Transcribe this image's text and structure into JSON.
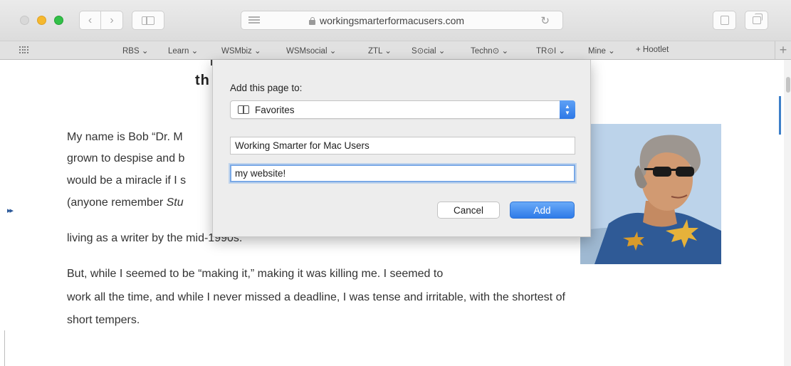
{
  "browser": {
    "url": "workingsmarterformacusers.com",
    "bookmarks_bar": [
      "RBS ⌄",
      "Learn ⌄",
      "WSMbiz ⌄",
      "WSMsocial ⌄",
      "ZTL ⌄",
      "S⊙cial ⌄",
      "Techn⊙ ⌄",
      "TR⊙I ⌄",
      "Mine ⌄",
      "+ Hootlet"
    ],
    "bookmark_plus": "+"
  },
  "page": {
    "heading_fragment": "th",
    "play_arrows": "▸▸",
    "paragraph1_lines": [
      "My name is Bob “Dr. M",
      "grown to despise and b",
      "would be a miracle if I s",
      "(anyone remember Stu",
      "living as a writer by the mid-1990s."
    ],
    "paragraph2_lines": [
      "But, while I seemed to be “making it,” making it was killing me. I seemed to",
      "work all the time, and while I never missed a deadline, I was tense and irritable, with the shortest of",
      "short tempers."
    ]
  },
  "dialog": {
    "title": "Add this page to:",
    "folder": "Favorites",
    "bookmark_title": "Working Smarter for Mac Users",
    "bookmark_description": "my website!",
    "cancel_label": "Cancel",
    "add_label": "Add"
  },
  "colors": {
    "accent": "#2e7ae8",
    "traffic_close": "#d8d8d8",
    "traffic_minimize": "#f5b82e",
    "traffic_zoom": "#32c048"
  },
  "icons": [
    "back-icon",
    "forward-icon",
    "sidebar-icon",
    "reader-icon",
    "lock-icon",
    "reload-icon",
    "share-icon",
    "tabs-icon",
    "grid-icon",
    "book-icon"
  ]
}
